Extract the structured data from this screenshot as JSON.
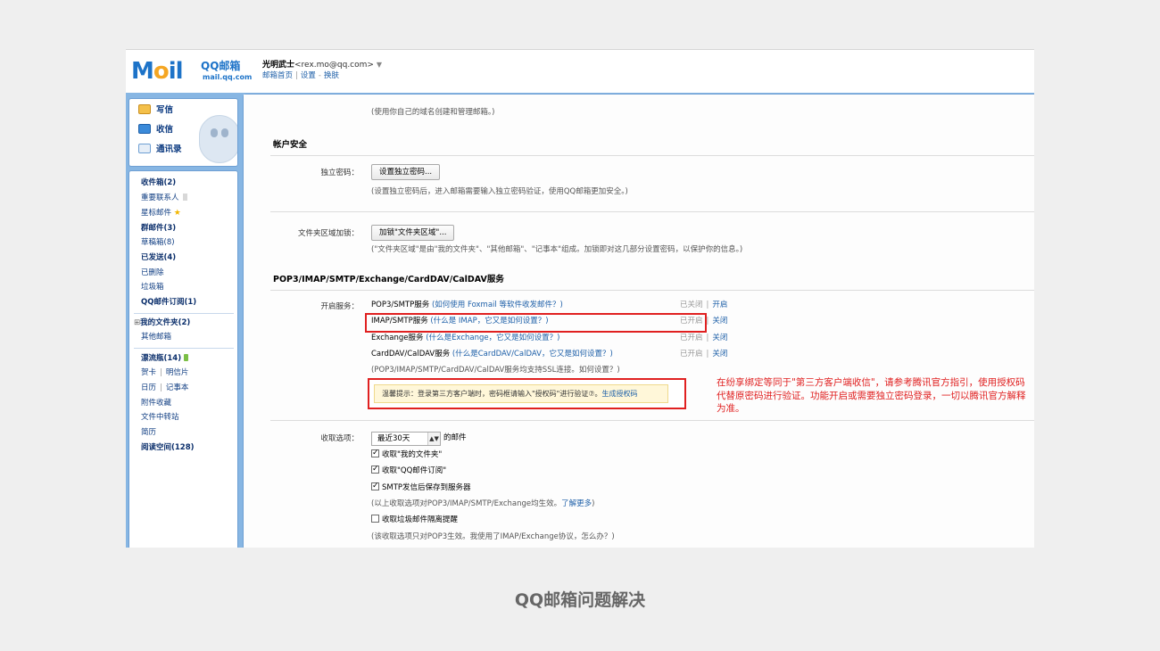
{
  "header": {
    "logo_text": "MOil",
    "brand": "QQ邮箱",
    "domain": "mail.qq.com",
    "user_name": "光明武士",
    "user_email": "<rex.mo@qq.com>",
    "links": [
      "邮箱首页",
      "设置",
      "换肤"
    ]
  },
  "sidebar": {
    "quick": [
      {
        "label": "写信",
        "icon": "compose-icon"
      },
      {
        "label": "收信",
        "icon": "inbox-icon"
      },
      {
        "label": "通讯录",
        "icon": "contacts-icon"
      }
    ],
    "folders": {
      "inbox": "收件箱(2)",
      "vip": "重要联系人",
      "starred": "星标邮件",
      "group": "群邮件(3)",
      "drafts": "草稿箱(8)",
      "sent": "已发送(4)",
      "deleted": "已删除",
      "spam": "垃圾箱",
      "subscriptions": "QQ邮件订阅(1)",
      "my_folders": "我的文件夹(2)",
      "other_mailbox": "其他邮箱",
      "bottle": "漂流瓶(14)",
      "card": "贺卡",
      "postcard": "明信片",
      "calendar": "日历",
      "notebook": "记事本",
      "attachments": "附件收藏",
      "transfer": "文件中转站",
      "resume": "简历",
      "reading": "阅读空间(128)"
    }
  },
  "main": {
    "domain_note": "(使用你自己的域名创建和管理邮箱。)",
    "account_security": {
      "title": "帐户安全",
      "indep_label": "独立密码：",
      "indep_button": "设置独立密码...",
      "indep_note": "(设置独立密码后，进入邮箱需要输入独立密码验证，使用QQ邮箱更加安全。)",
      "folder_label": "文件夹区域加锁：",
      "folder_button": "加锁\"文件夹区域\"...",
      "folder_note": "(\"文件夹区域\"是由\"我的文件夹\"、\"其他邮箱\"、\"记事本\"组成。加锁即对这几部分设置密码，以保护你的信息。)"
    },
    "services": {
      "title": "POP3/IMAP/SMTP/Exchange/CardDAV/CalDAV服务",
      "enable_label": "开启服务：",
      "rows": [
        {
          "name": "POP3/SMTP服务",
          "hint": "(如何使用 Foxmail 等软件收发邮件？)",
          "status": "已关闭",
          "action": "开启"
        },
        {
          "name": "IMAP/SMTP服务",
          "hint": "(什么是 IMAP，它又是如何设置？)",
          "status": "已开启",
          "action": "关闭"
        },
        {
          "name": "Exchange服务",
          "hint": "(什么是Exchange，它又是如何设置？)",
          "status": "已开启",
          "action": "关闭"
        },
        {
          "name": "CardDAV/CalDAV服务",
          "hint": "(什么是CardDAV/CalDAV，它又是如何设置？)",
          "status": "已开启",
          "action": "关闭"
        }
      ],
      "ssl_note": "(POP3/IMAP/SMTP/CardDAV/CalDAV服务均支持SSL连接。如何设置？)",
      "tip": "温馨提示：登录第三方客户端时，密码框请输入\"授权码\"进行验证⑦。",
      "tip_link": "生成授权码",
      "annotation": "在纷享绑定等同于\"第三方客户端收信\"，请参考腾讯官方指引，使用授权码代替原密码进行验证。功能开启或需要独立密码登录，一切以腾讯官方解释为准。"
    },
    "receive": {
      "label": "收取选项：",
      "range_value": "最近30天",
      "range_suffix": "的邮件",
      "checks": [
        {
          "label": "收取\"我的文件夹\"",
          "checked": true
        },
        {
          "label": "收取\"QQ邮件订阅\"",
          "checked": true
        },
        {
          "label": "SMTP发信后保存到服务器",
          "checked": true
        }
      ],
      "note1": "(以上收取选项对POP3/IMAP/SMTP/Exchange均生效。",
      "note1_link": "了解更多",
      "note1_end": ")",
      "spam_label": "收取垃圾邮件隔离提醒",
      "spam_checked": false,
      "note2": "(该收取选项只对POP3生效。我使用了IMAP/Exchange协议，怎么办？)"
    }
  },
  "caption": "QQ邮箱问题解决",
  "colors": {
    "accent": "#1d73c8",
    "annotation": "#e02020",
    "band": "#87b6e3"
  }
}
